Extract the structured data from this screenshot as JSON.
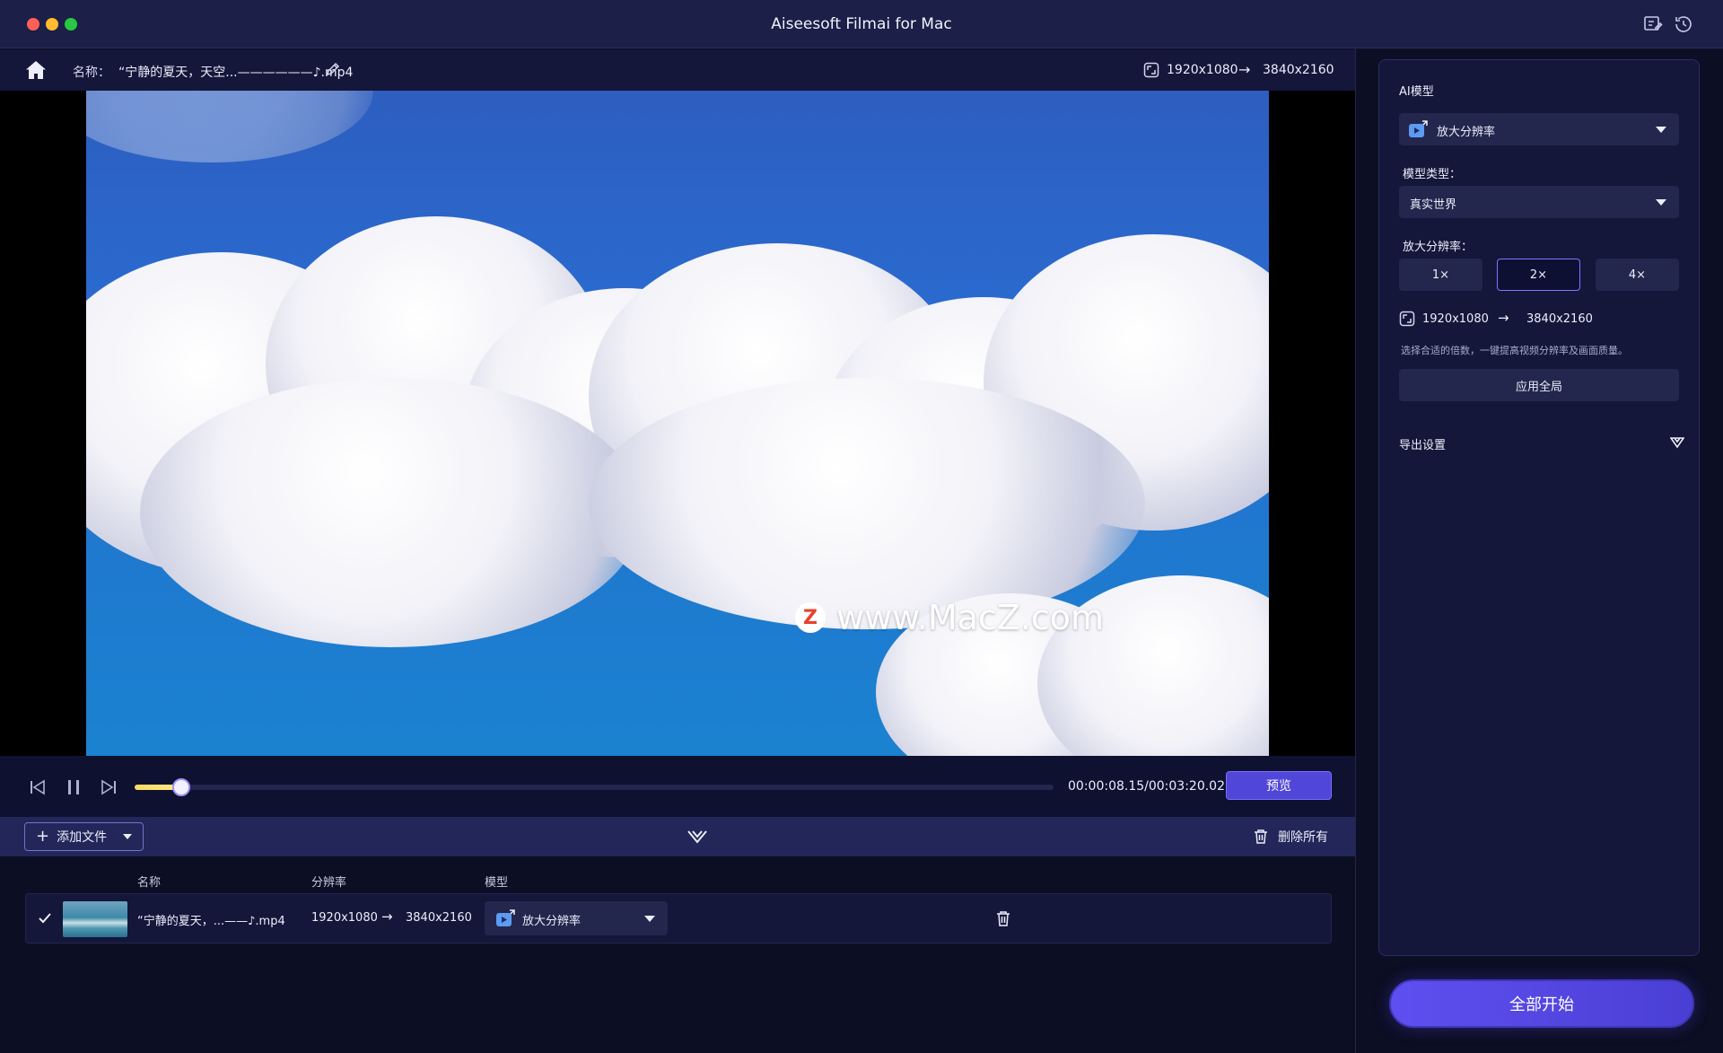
{
  "window": {
    "title": "Aiseesoft Filmai for Mac"
  },
  "titlebar": {
    "icons": [
      "feedback-icon",
      "history-icon"
    ]
  },
  "infobar": {
    "name_label": "名称：",
    "file_name": "“宁静的夏天，天空...——————♪.mp4",
    "source_resolution": "1920x1080",
    "arrow": "→",
    "target_resolution": "3840x2160"
  },
  "preview": {
    "watermark_text": "www.MacZ.com",
    "watermark_logo": "Z"
  },
  "player": {
    "progress": 0.051,
    "time": "00:00:08.15/00:03:20.02",
    "preview_label": "预览"
  },
  "filebar": {
    "add_file_label": "添加文件",
    "delete_all_label": "删除所有"
  },
  "file_list": {
    "columns": {
      "name": "名称",
      "resolution": "分辨率",
      "model": "模型"
    },
    "rows": [
      {
        "name": "“宁静的夏天，...——♪.mp4",
        "source_resolution": "1920x1080",
        "arrow": "→",
        "target_resolution": "3840x2160",
        "model": "放大分辨率"
      }
    ]
  },
  "panel": {
    "ai_model_label": "AI模型",
    "ai_model_value": "放大分辨率",
    "model_type_label": "模型类型：",
    "model_type_value": "真实世界",
    "upscale_label": "放大分辨率：",
    "scales": [
      "1×",
      "2×",
      "4×"
    ],
    "selected_scale": "2×",
    "source_resolution": "1920x1080",
    "arrow": "→",
    "target_resolution": "3840x2160",
    "hint": "选择合适的倍数，一键提高视频分辨率及画面质量。",
    "apply_all_label": "应用全局",
    "export_settings_label": "导出设置"
  },
  "start_all_label": "全部开始",
  "colors": {
    "accent": "#5046d8",
    "progress_fill": "#f4dc65",
    "panel_bg": "#14163a",
    "sky": "#2a6bd0"
  }
}
